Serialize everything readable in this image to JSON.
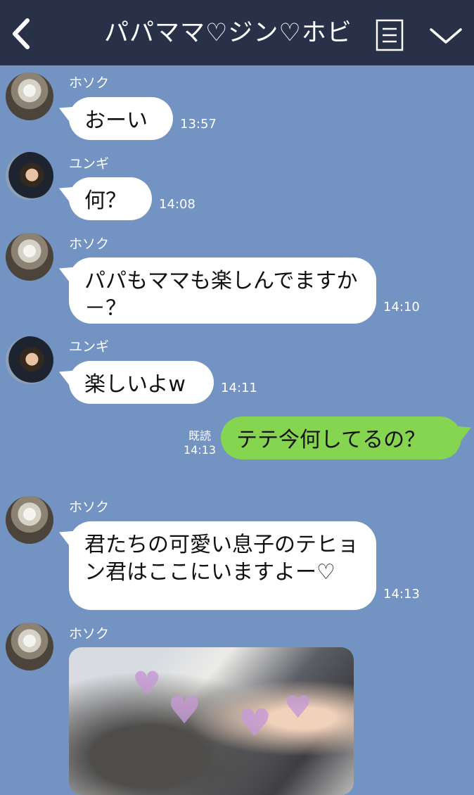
{
  "header": {
    "title": "パパママ♡ジン♡ホビ",
    "colors": {
      "background": "#283147",
      "text": "#ffffff"
    },
    "icons": {
      "back": "chevron-left-icon",
      "menu": "list-menu-icon",
      "down": "chevron-down-icon"
    }
  },
  "chat": {
    "background_color": "#7393c3",
    "messages": [
      {
        "sender": "ホソク",
        "text": "おーい",
        "time": "13:57"
      },
      {
        "sender": "ユンギ",
        "text": "何？",
        "time": "14:08"
      },
      {
        "sender": "ホソク",
        "text": "パパもママも楽しんでますか－？",
        "time": "14:10"
      },
      {
        "sender": "ユンギ",
        "text": "楽しいよw",
        "time": "14:11"
      },
      {
        "sender": "self",
        "text": "テテ今何してるの？",
        "time": "14:13",
        "read": "既読"
      },
      {
        "sender": "ホソク",
        "text": "君たちの可愛い息子のテヒョン君はここにいますよー♡",
        "time": "14:13"
      },
      {
        "sender": "ホソク",
        "type": "photo",
        "photo_icon": "photo-image-icon",
        "sticker_icon": "heart-sticker-icon"
      }
    ]
  },
  "colors": {
    "incoming_bubble": "#ffffff",
    "outgoing_bubble": "#85d551"
  }
}
